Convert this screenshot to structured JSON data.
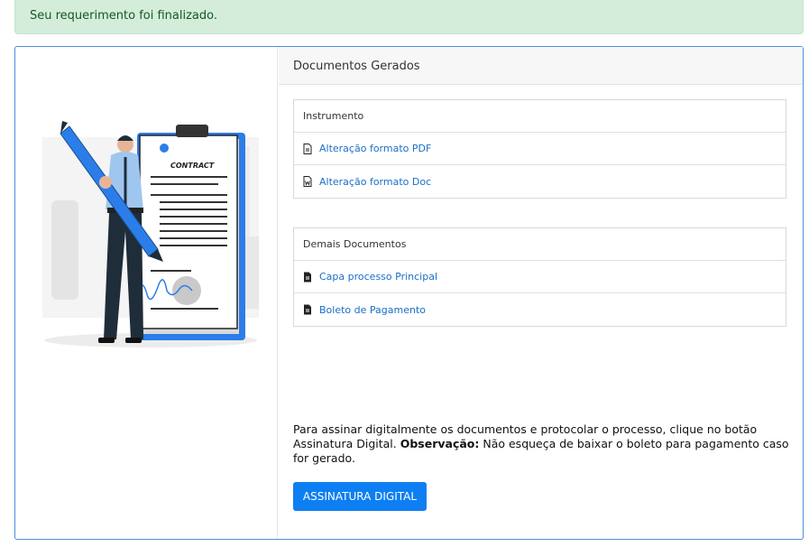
{
  "alert": {
    "message": "Seu requerimento foi finalizado."
  },
  "illustration": {
    "contract_label": "CONTRACT"
  },
  "panel": {
    "title": "Documentos Gerados",
    "instrumento": {
      "header": "Instrumento",
      "items": [
        {
          "label": "Alteração formato PDF",
          "icon": "file-pdf-icon"
        },
        {
          "label": "Alteração formato Doc",
          "icon": "file-word-icon"
        }
      ]
    },
    "demais": {
      "header": "Demais Documentos",
      "items": [
        {
          "label": "Capa processo Principal",
          "icon": "file-icon"
        },
        {
          "label": "Boleto de Pagamento",
          "icon": "file-icon"
        }
      ]
    },
    "note": {
      "text_before": "Para assinar digitalmente os documentos e protocolar o processo, clique no botão Assinatura Digital. ",
      "bold": "Observação:",
      "text_after": " Não esqueça de baixar o boleto para pagamento caso for gerado."
    },
    "button_label": "ASSINATURA DIGITAL"
  },
  "colors": {
    "accent": "#0d7ff2",
    "link": "#1a6fc6",
    "alert_bg": "#d4edda",
    "alert_text": "#155724"
  }
}
